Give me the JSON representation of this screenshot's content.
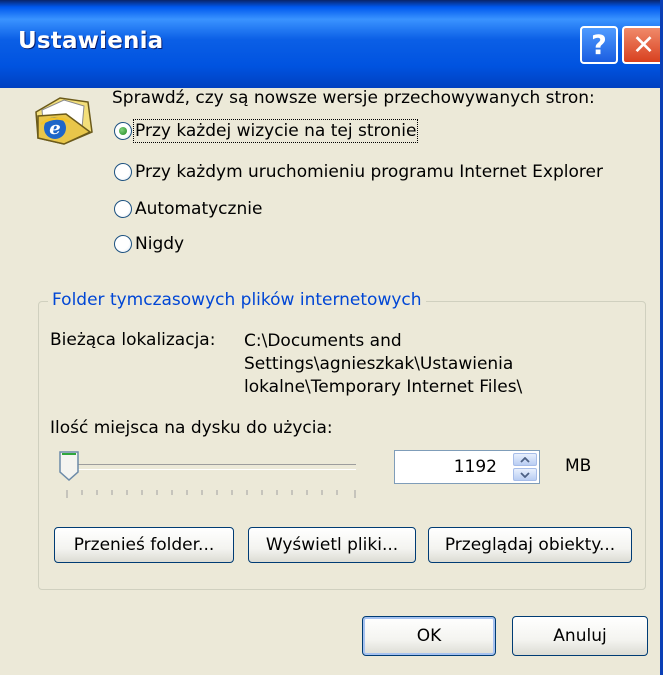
{
  "window": {
    "title": "Ustawienia"
  },
  "title_buttons": {
    "help_glyph": "?",
    "close_glyph": "✕"
  },
  "check_prompt": "Sprawdź, czy są nowsze wersje przechowywanych stron:",
  "options": [
    {
      "label": "Przy każdej wizycie na tej stronie",
      "checked": true
    },
    {
      "label": "Przy każdym uruchomieniu programu Internet Explorer",
      "checked": false
    },
    {
      "label": "Automatycznie",
      "checked": false
    },
    {
      "label": "Nigdy",
      "checked": false
    }
  ],
  "temp_folder": {
    "group_title": "Folder tymczasowych plików internetowych",
    "location_label": "Bieżąca lokalizacja:",
    "location_value": "C:\\Documents and Settings\\agnieszkak\\Ustawienia lokalne\\Temporary Internet Files\\",
    "space_label": "Ilość miejsca na dysku do użycia:",
    "space_value": "1192",
    "space_unit": "MB",
    "slider_fraction": 0.01,
    "buttons": {
      "move": "Przenieś folder...",
      "view_files": "Wyświetl pliki...",
      "view_objects": "Przeglądaj obiekty..."
    }
  },
  "dialog_buttons": {
    "ok": "OK",
    "cancel": "Anuluj"
  },
  "colors": {
    "title_bar": "#0058ee",
    "group_title": "#0046d5",
    "dialog_bg": "#ece9d8"
  },
  "icons": [
    "internet-explorer-folder-icon",
    "help-icon",
    "close-icon",
    "slider-thumb-icon",
    "spin-up-icon",
    "spin-down-icon"
  ]
}
